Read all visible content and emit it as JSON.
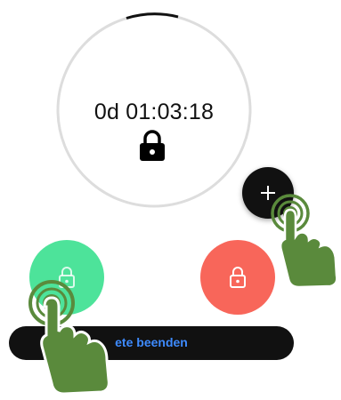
{
  "timer": {
    "display": "0d 01:03:18",
    "ring_progress_fraction": 0.05
  },
  "buttons": {
    "add_icon": "plus-icon",
    "green_lock_icon": "lock-icon",
    "red_lock_icon": "lock-icon",
    "end_label": "ete beenden"
  },
  "colors": {
    "ring_track": "#dddddd",
    "ring_progress": "#111111",
    "green": "#4de39a",
    "red": "#f8665a",
    "end_button_bg": "#111111",
    "end_button_text": "#3e8bff",
    "gesture_hand": "#5a8a3c"
  }
}
